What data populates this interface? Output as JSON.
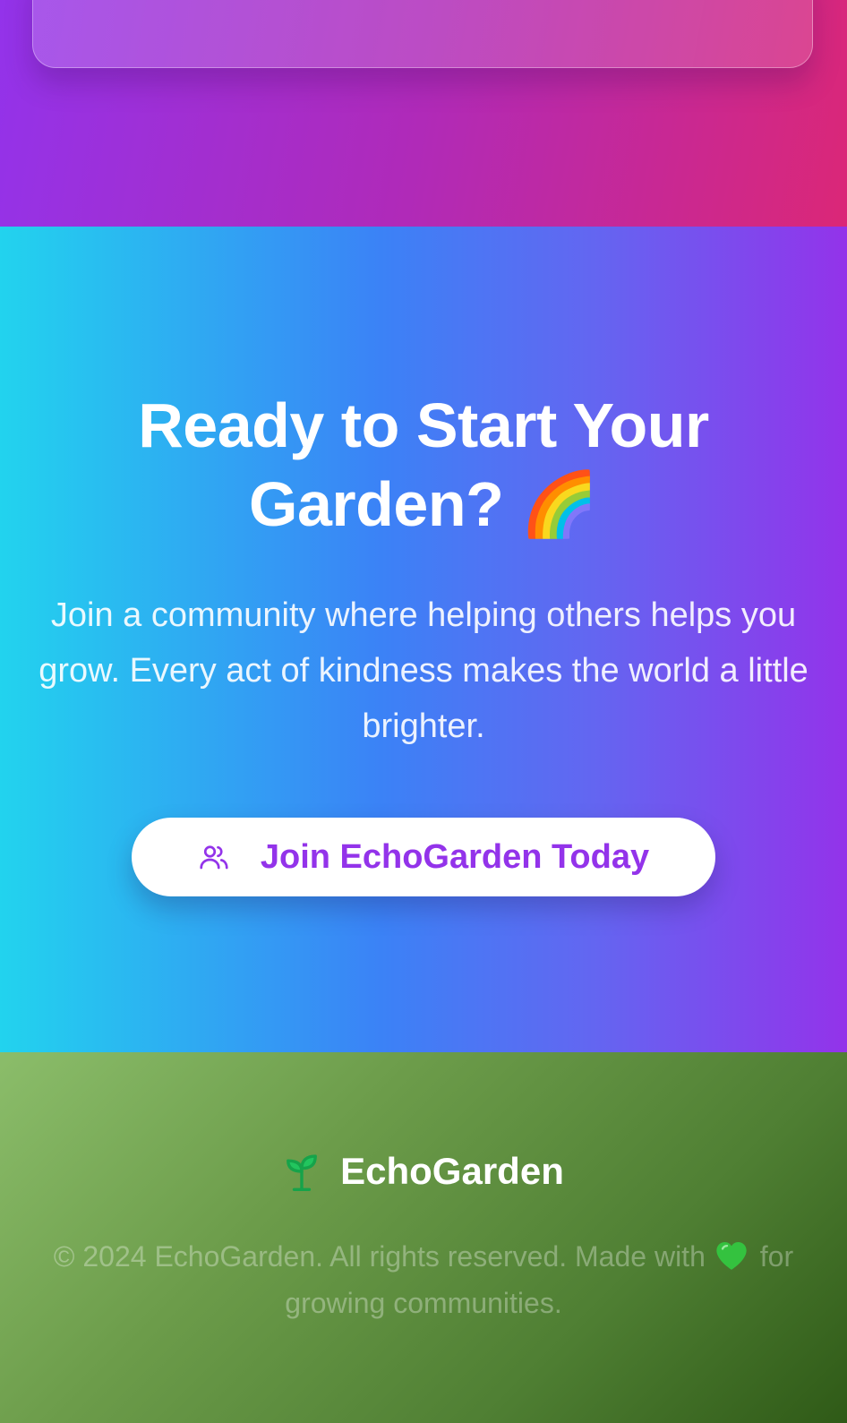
{
  "cta": {
    "title": "Ready to Start Your Garden? 🌈",
    "text": "Join a community where helping others helps you grow. Every act of kindness makes the world a little brighter.",
    "button_label": "Join EchoGarden Today",
    "button_icon": "users-icon"
  },
  "footer": {
    "brand_name": "EchoGarden",
    "brand_icon": "seedling-icon",
    "copyright_prefix": "© 2024 EchoGarden. All rights reserved. Made with",
    "copyright_suffix": "for growing communities.",
    "heart_icon": "green-heart-icon"
  },
  "colors": {
    "accent_purple": "#9333ea",
    "cyan": "#22d3ee",
    "footer_green": "#4f7f33"
  }
}
